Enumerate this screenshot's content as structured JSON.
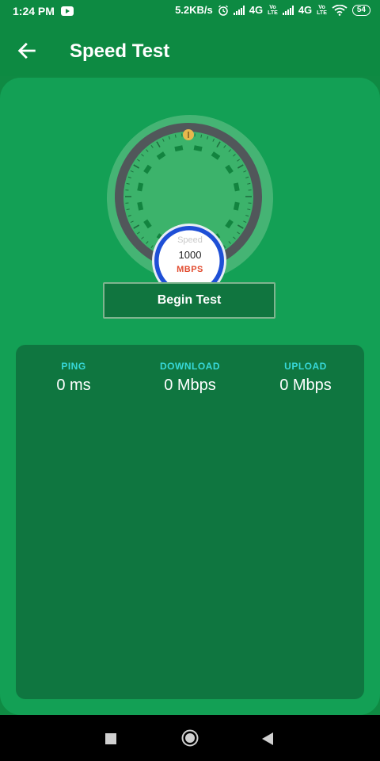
{
  "status_bar": {
    "time": "1:24 PM",
    "network_speed": "5.2KB/s",
    "sim1_type": "4G",
    "sim2_type": "4G",
    "volte_top": "Vo",
    "volte_bottom": "LTE",
    "battery": "54",
    "icons": [
      "youtube-icon",
      "alarm-icon",
      "signal-icon",
      "wifi-icon",
      "battery-icon"
    ]
  },
  "app_bar": {
    "title": "Speed Test",
    "back_icon": "arrow-left-icon"
  },
  "gauge": {
    "label": "Speed",
    "value": "1000",
    "unit": "MBPS",
    "colors": {
      "ring": "#51575a",
      "face": "#3cb36b",
      "inner_ring": "#1e4fd6",
      "needle_knob": "#e7b84d",
      "unit_text": "#e24b2f"
    }
  },
  "actions": {
    "begin_label": "Begin Test"
  },
  "results": {
    "ping": {
      "label": "PING",
      "value": "0 ms"
    },
    "download": {
      "label": "DOWNLOAD",
      "value": "0 Mbps"
    },
    "upload": {
      "label": "UPLOAD",
      "value": "0 Mbps"
    },
    "label_color": "#37d8d8"
  },
  "nav_bar": {
    "icons": [
      "recents-square-icon",
      "home-circle-icon",
      "back-triangle-icon"
    ]
  },
  "colors": {
    "primary": "#0d8a42",
    "card": "#13a055",
    "panel": "#0f7640"
  }
}
